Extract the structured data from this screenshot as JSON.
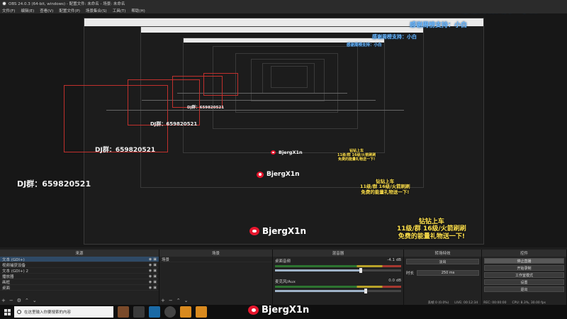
{
  "window": {
    "title": "OBS 24.0.3 (64-bit, windows) - 配置文件: 未命名 - 场景: 未命名"
  },
  "menu": [
    "文件(F)",
    "编辑(E)",
    "查看(V)",
    "配置文件(P)",
    "场景集合(S)",
    "工具(T)",
    "帮助(H)"
  ],
  "overlay": {
    "dj_group": "DJ群：659820521",
    "thanks": "感谢周榜支持：小白",
    "weibo_name": "BjergX1n",
    "vote_line1": "钻钻上车",
    "vote_line2": "11级/群 16级/火箭刷刷",
    "vote_line3": "免费的能量礼物送一下!"
  },
  "docks": {
    "headers": {
      "sources": "来源",
      "scenes": "场景",
      "mixer": "混音器",
      "transitions": "转场特效",
      "controls": "控件"
    },
    "sources": [
      {
        "label": "文本 (GDI+)",
        "active": true
      },
      {
        "label": "视频捕获设备",
        "active": false
      },
      {
        "label": "文本 (GDI+) 2",
        "active": false
      },
      {
        "label": "播放器",
        "active": false
      },
      {
        "label": "画框",
        "active": false
      },
      {
        "label": "桌面",
        "active": false
      }
    ],
    "scenes": [
      {
        "label": "场景",
        "active": false
      }
    ],
    "mixer": [
      {
        "name": "桌面音频",
        "db": "-4.1 dB",
        "level": 0.68
      },
      {
        "name": "麦克风/Aux",
        "db": "0.0 dB",
        "level": 0.72
      }
    ],
    "transitions": {
      "type": "淡出",
      "duration_label": "时长",
      "duration": "250 ms"
    },
    "controls": [
      "停止直播",
      "开始录制",
      "工作室模式",
      "设置",
      "退出"
    ]
  },
  "statusbar": {
    "dropped": "丢帧 0 (0.0%)",
    "live": "LIVE: 00:12:34",
    "rec": "REC: 00:00:00",
    "cpu": "CPU: 8.3%, 30.00 fps"
  },
  "taskbar": {
    "search_placeholder": "在这里输入你要搜索的内容"
  },
  "colors": {
    "red_box": "#c0302d",
    "thanks_blue": "#6ab8ff",
    "vote_yellow": "#ffe14d",
    "weibo_red": "#e6162d"
  }
}
